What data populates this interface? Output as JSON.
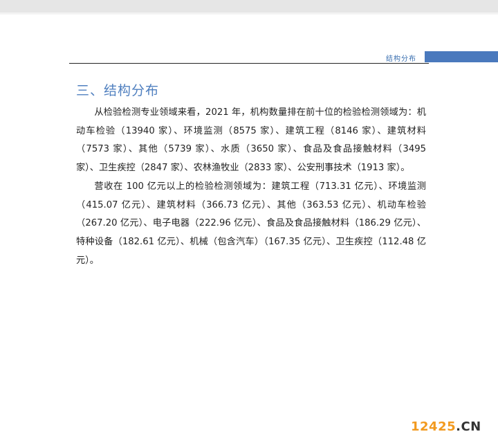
{
  "header": {
    "section_label": "结构分布"
  },
  "section": {
    "title": "三、结构分布"
  },
  "paragraphs": [
    "从检验检测专业领域来看，2021 年，机构数量排在前十位的检验检测领域为：机动车检验（13940 家）、环境监测（8575 家）、建筑工程（8146 家）、建筑材料（7573 家）、其他（5739 家）、水质（3650 家）、食品及食品接触材料（3495 家）、卫生疾控（2847 家）、农林渔牧业（2833 家）、公安刑事技术（1913 家）。",
    "营收在 100 亿元以上的检验检测领域为：建筑工程（713.31 亿元）、环境监测（415.07 亿元）、建筑材料（366.73 亿元）、其他（363.53 亿元）、机动车检验（267.20 亿元）、电子电器（222.96 亿元）、食品及食品接触材料（186.29 亿元）、特种设备（182.61 亿元）、机械（包含汽车）（167.35 亿元）、卫生疾控（112.48 亿元）。"
  ],
  "watermark": {
    "number": "12425",
    "tld": ".CN"
  },
  "colors": {
    "accent": "#4a79bd",
    "title": "#4f7fbf",
    "watermark": "#f29a1f"
  }
}
